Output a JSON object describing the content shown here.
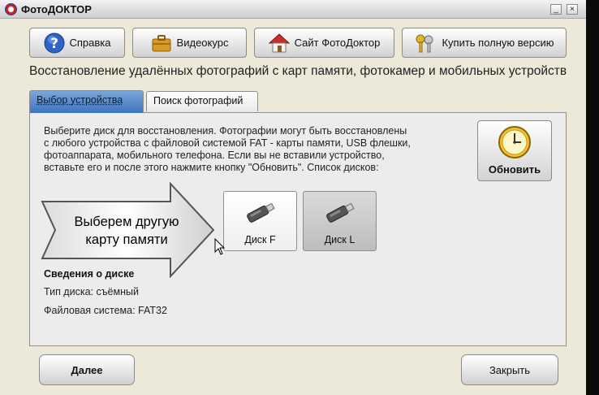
{
  "window": {
    "title": "ФотоДОКТОР"
  },
  "toolbar": {
    "help_label": "Справка",
    "video_label": "Видеокурс",
    "site_label": "Сайт ФотоДоктор",
    "buy_label": "Купить полную версию"
  },
  "subtitle": "Восстановление удалённых фотографий с карт памяти, фотокамер и мобильных устройств",
  "tabs": [
    {
      "label": "Выбор устройства",
      "active": true
    },
    {
      "label": "Поиск фотографий",
      "active": false
    }
  ],
  "instructions": [
    "Выберите диск для восстановления. Фотографии могут быть восстановлены",
    "с любого устройства с файловой системой FAT - карты памяти, USB флешки,",
    "фотоаппарата, мобильного телефона. Если вы не вставили устройство,",
    "вставьте его и после этого нажмите кнопку \"Обновить\". Список дисков:"
  ],
  "refresh_label": "Обновить",
  "drives": [
    {
      "label": "Диск F",
      "selected": false
    },
    {
      "label": "Диск L",
      "selected": true
    }
  ],
  "callout": [
    "Выберем другую",
    "карту памяти"
  ],
  "disk_info": {
    "title": "Сведения о диске",
    "type": "Тип диска: съёмный",
    "filesystem": "Файловая система: FAT32"
  },
  "footer": {
    "next_label": "Далее",
    "close_label": "Закрыть"
  },
  "colors": {
    "tab_active": "#3f74be",
    "window_bg": "#ece9d8",
    "accent_red": "#d21d1d"
  }
}
